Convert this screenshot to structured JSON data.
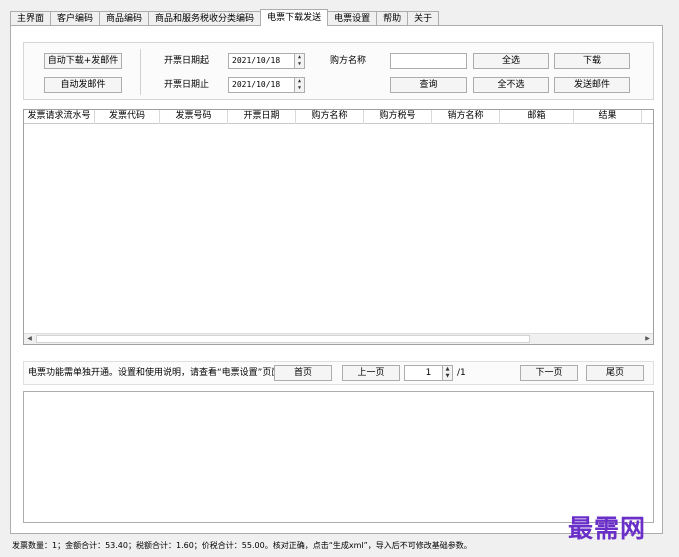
{
  "tabs": [
    {
      "label": "主界面"
    },
    {
      "label": "客户编码"
    },
    {
      "label": "商品编码"
    },
    {
      "label": "商品和服务税收分类编码"
    },
    {
      "label": "电票下载发送"
    },
    {
      "label": "电票设置"
    },
    {
      "label": "帮助"
    },
    {
      "label": "关于"
    }
  ],
  "active_tab": "电票下载发送",
  "controls": {
    "auto_download_send_label": "自动下载+发邮件",
    "auto_send_label": "自动发邮件",
    "start_date_label": "开票日期起",
    "start_date_value": "2021/10/18",
    "end_date_label": "开票日期止",
    "end_date_value": "2021/10/18",
    "buyer_name_label": "购方名称",
    "buyer_name_value": "",
    "select_all_label": "全选",
    "download_label": "下载",
    "query_label": "查询",
    "select_none_label": "全不选",
    "send_email_label": "发送邮件"
  },
  "grid": {
    "columns": [
      "发票请求流水号",
      "发票代码",
      "发票号码",
      "开票日期",
      "购方名称",
      "购方税号",
      "销方名称",
      "邮箱",
      "结果"
    ],
    "rows": []
  },
  "pager": {
    "notice": "电票功能需单独开通。设置和使用说明，请查看“电票设置”页面。",
    "first_label": "首页",
    "prev_label": "上一页",
    "page_value": "1",
    "total_pages": "/1",
    "next_label": "下一页",
    "last_label": "尾页"
  },
  "log_text": "",
  "status_bar": "发票数量：1；金额合计：53.40；税额合计：1.60；价税合计：55.00。核对正确，点击“生成xml”，导入后不可修改基础参数。",
  "watermark": "最需网",
  "colors": {
    "watermark": "#6a2fc8",
    "border": "#adadad",
    "background": "#f0f0f0"
  }
}
